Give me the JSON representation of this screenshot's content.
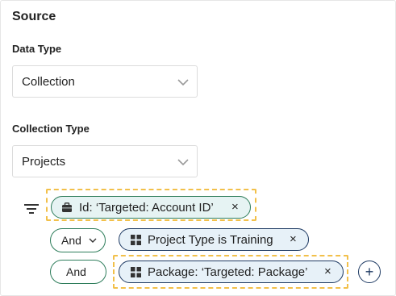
{
  "source": {
    "title": "Source",
    "data_type": {
      "label": "Data Type",
      "value": "Collection"
    },
    "collection_type": {
      "label": "Collection Type",
      "value": "Projects"
    }
  },
  "filters": {
    "root_chip": {
      "text": "Id: ‘Targeted: Account ID’",
      "close": "×",
      "icon": "briefcase-icon"
    },
    "rows": [
      {
        "operator": "And",
        "chip": {
          "text": "Project Type is Training",
          "close": "×",
          "icon": "grid-icon"
        }
      },
      {
        "operator": "And",
        "chip": {
          "text": "Package: ‘Targeted: Package’",
          "close": "×",
          "icon": "grid-icon"
        }
      }
    ],
    "add_button": "+"
  },
  "colors": {
    "green_border": "#2e7d5b",
    "blue_border": "#1e3a63",
    "highlight_dash": "#f2c04a"
  }
}
